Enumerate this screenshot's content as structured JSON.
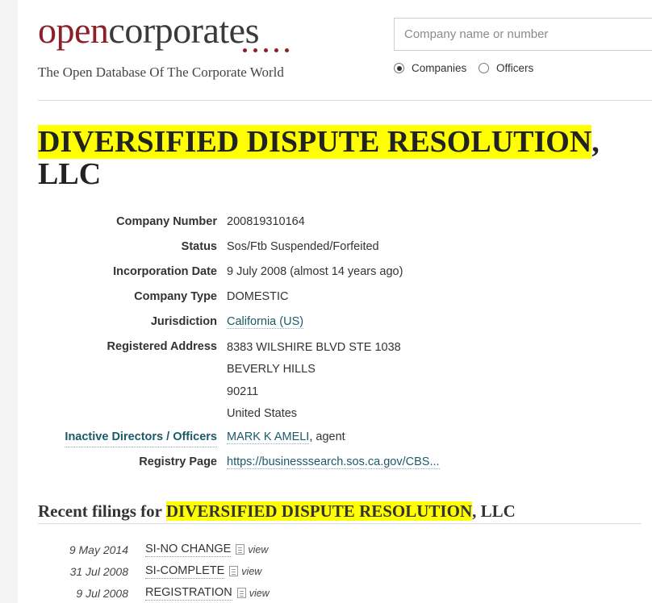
{
  "brand": {
    "logo_part1": "open",
    "logo_part2": "corporates",
    "tagline": "The Open Database Of The Corporate World"
  },
  "search": {
    "placeholder": "Company name or number",
    "value": "",
    "options": [
      {
        "label": "Companies",
        "checked": true
      },
      {
        "label": "Officers",
        "checked": false
      }
    ]
  },
  "company": {
    "name": "DIVERSIFIED DISPUTE RESOLUTION",
    "suffix": ", LLC",
    "attributes": {
      "company_number": {
        "label": "Company Number",
        "value": "200819310164"
      },
      "status": {
        "label": "Status",
        "value": "Sos/Ftb Suspended/Forfeited"
      },
      "incorporation_date": {
        "label": "Incorporation Date",
        "value": "9 July 2008 (almost 14 years ago)"
      },
      "company_type": {
        "label": "Company Type",
        "value": "DOMESTIC"
      },
      "jurisdiction": {
        "label": "Jurisdiction",
        "value": "California (US)"
      },
      "registered_address": {
        "label": "Registered Address",
        "lines": [
          "8383 WILSHIRE BLVD STE 1038",
          "BEVERLY HILLS",
          "90211",
          "United States"
        ]
      },
      "inactive_officers": {
        "label": "Inactive Directors / Officers",
        "name": "MARK K AMELI",
        "role": ", agent"
      },
      "registry_page": {
        "label": "Registry Page",
        "value": "https://businesssearch.sos.ca.gov/CBS..."
      }
    }
  },
  "filings": {
    "heading_prefix": "Recent filings for ",
    "heading_name": "DIVERSIFIED DISPUTE RESOLUTION",
    "heading_suffix": ", LLC",
    "view_label": "view",
    "items": [
      {
        "date": "9 May 2014",
        "title": "SI-NO CHANGE"
      },
      {
        "date": "31 Jul 2008",
        "title": "SI-COMPLETE"
      },
      {
        "date": "9 Jul 2008",
        "title": "REGISTRATION"
      }
    ]
  },
  "colors": {
    "brand_red": "#8b1f2a",
    "highlight": "#ffff00",
    "link": "#1a5a6b"
  }
}
